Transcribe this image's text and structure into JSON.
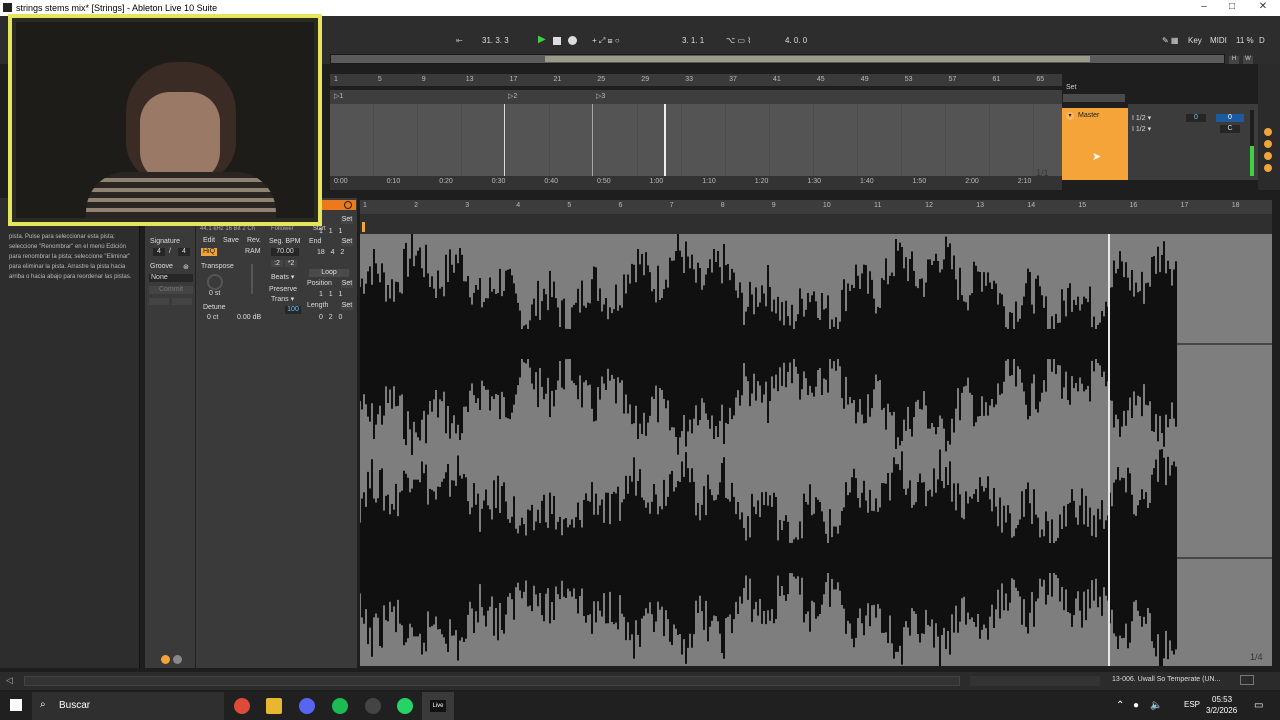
{
  "window": {
    "title": "strings stems mix* [Strings] - Ableton Live 10 Suite",
    "minimize": "–",
    "maximize": "□",
    "close": "✕"
  },
  "transport": {
    "position": "31.  3.  3",
    "loop_start": "3.  1.  1",
    "loop_length": "4.  0.  0",
    "key_label": "Key",
    "midi_label": "MIDI",
    "cpu": "11 %",
    "disk": "D"
  },
  "arrangement": {
    "ruler": [
      "1",
      "5",
      "9",
      "13",
      "17",
      "21",
      "25",
      "29",
      "33",
      "37",
      "41",
      "45",
      "49",
      "53",
      "57",
      "61",
      "65"
    ],
    "locators": [
      "1",
      "2",
      "3"
    ],
    "time": [
      "0:00",
      "0:10",
      "0:20",
      "0:30",
      "0:40",
      "0:50",
      "1:00",
      "1:10",
      "1:20",
      "1:30",
      "1:40",
      "1:50",
      "2:00",
      "2:10"
    ],
    "page": "1/1",
    "set_label": "Set",
    "master": {
      "label": "Master",
      "routing_a": "1/2",
      "routing_b": "1/2",
      "vol": "0",
      "pan": "C",
      "send": "0"
    }
  },
  "info_text": "pista. Pulse para seleccionar esta pista; seleccione \"Renombrar\" en el menú Edición para renombrar la pista; seleccione \"Eliminar\" para eliminar la pista. Arrastre la pista hacia arriba o hacia abajo para reordenar las pistas.",
  "clip": {
    "signature_label": "Signature",
    "sig_num": "4",
    "sig_den": "4",
    "groove_label": "Groove",
    "groove_value": "None",
    "commit": "Commit",
    "file_info": "44.1 kHz 16 Bit 2 Ch",
    "edit": "Edit",
    "save": "Save",
    "rev": "Rev.",
    "hiq": "HiQ",
    "ram": "RAM",
    "follower": "Follower",
    "transpose_label": "Transpose",
    "transpose_value": "0 st",
    "detune_label": "Detune",
    "detune_value": "0 ct",
    "gain_value": "0.00 dB",
    "seg_bpm_label": "Seg. BPM",
    "seg_bpm": "70.00",
    "half": ":2",
    "double": "*2",
    "warp_mode": "Beats",
    "preserve_label": "Preserve",
    "preserve_value": "Trans",
    "preserve_amount": "100",
    "start_label": "Start",
    "end_label": "End",
    "end_value": [
      "18",
      "4",
      "2"
    ],
    "start_value": [
      "1",
      "1",
      "1"
    ],
    "loop_label": "Loop",
    "position_label": "Position",
    "position_value": [
      "1",
      "1",
      "1"
    ],
    "length_label": "Length",
    "length_value": [
      "0",
      "2",
      "0"
    ],
    "set": "Set"
  },
  "sample": {
    "ruler": [
      "1",
      "2",
      "3",
      "4",
      "5",
      "6",
      "7",
      "8",
      "9",
      "10",
      "11",
      "12",
      "13",
      "14",
      "15",
      "16",
      "17",
      "18"
    ],
    "page": "1/4"
  },
  "statusbar": {
    "track_name": "13-006. Uwall So Temperate (UN..."
  },
  "taskbar": {
    "search": "Buscar",
    "lang": "ESP",
    "time": "05:53",
    "date": "3/2/2026"
  }
}
